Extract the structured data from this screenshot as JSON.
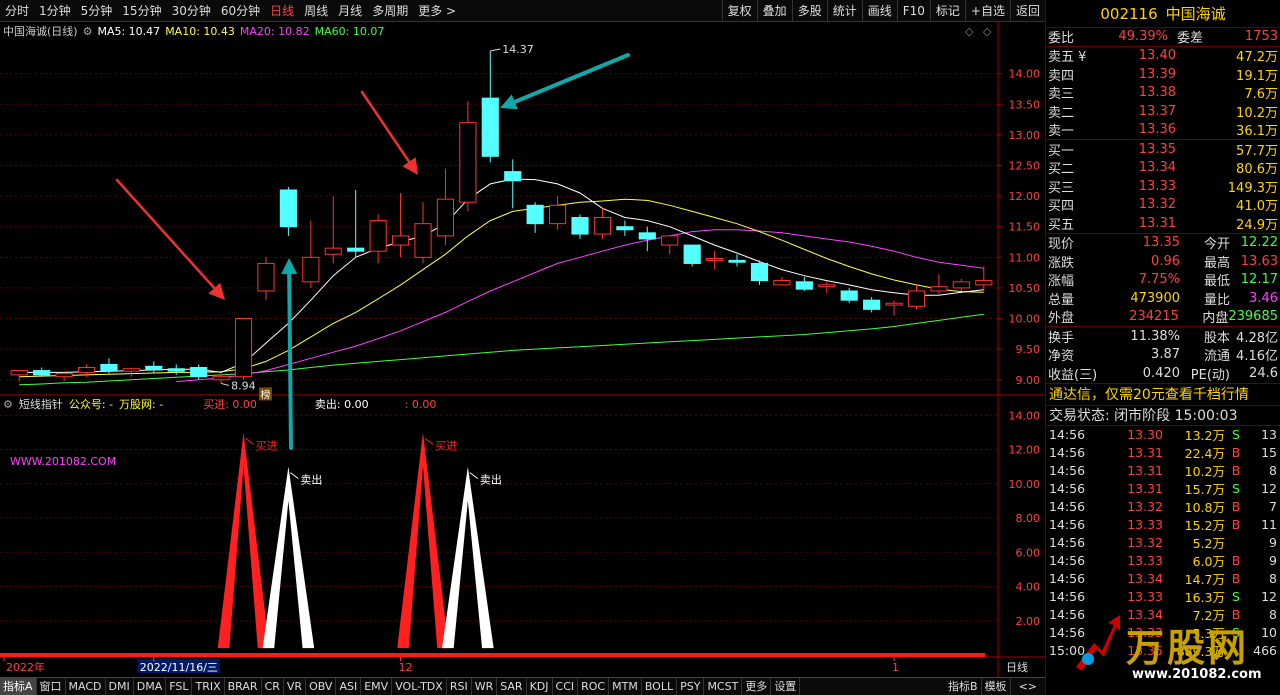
{
  "toolbar": {
    "periods": [
      "分时",
      "1分钟",
      "5分钟",
      "15分钟",
      "30分钟",
      "60分钟",
      "日线",
      "周线",
      "月线",
      "多周期",
      "更多"
    ],
    "active_period": "日线",
    "more_arrow": ">",
    "right_buttons": [
      "复权",
      "叠加",
      "多股",
      "统计",
      "画线",
      "F10",
      "标记",
      "+自选",
      "返回"
    ]
  },
  "main_legend": {
    "title": "中国海诚(日线)",
    "ma5": "MA5: 10.47",
    "ma10": "MA10: 10.43",
    "ma20": "MA20: 10.82",
    "ma60": "MA60: 10.07",
    "ma5_color": "#ffffff",
    "ma10_color": "#ffff40",
    "ma20_color": "#ff40ff",
    "ma60_color": "#40ff40"
  },
  "indicator_legend": {
    "name": "短线指针",
    "gzh": "公众号: -",
    "site": "万股网: -",
    "buy": "买进: 0.00",
    "sell": "卖出: 0.00",
    "extra": ": 0.00"
  },
  "chart_data": {
    "type": "candlestick",
    "y_ticks": [
      "14.00",
      "13.50",
      "13.00",
      "12.50",
      "12.00",
      "11.50",
      "11.00",
      "10.50",
      "10.00",
      "9.50",
      "9.00"
    ],
    "ylim": [
      8.8,
      14.55
    ],
    "high_label": "14.37",
    "low_label": "8.94",
    "badge": "榜",
    "candles": [
      {
        "o": 9.08,
        "h": 9.15,
        "l": 8.97,
        "c": 9.15
      },
      {
        "o": 9.15,
        "h": 9.2,
        "l": 9.05,
        "c": 9.08
      },
      {
        "o": 9.05,
        "h": 9.12,
        "l": 8.98,
        "c": 9.1
      },
      {
        "o": 9.12,
        "h": 9.25,
        "l": 9.05,
        "c": 9.2
      },
      {
        "o": 9.25,
        "h": 9.35,
        "l": 9.1,
        "c": 9.15
      },
      {
        "o": 9.14,
        "h": 9.2,
        "l": 9.05,
        "c": 9.18
      },
      {
        "o": 9.22,
        "h": 9.3,
        "l": 9.12,
        "c": 9.16
      },
      {
        "o": 9.18,
        "h": 9.25,
        "l": 9.08,
        "c": 9.14
      },
      {
        "o": 9.2,
        "h": 9.25,
        "l": 9.0,
        "c": 9.05
      },
      {
        "o": 9.0,
        "h": 9.1,
        "l": 8.94,
        "c": 9.05
      },
      {
        "o": 9.05,
        "h": 10.0,
        "l": 9.0,
        "c": 10.0
      },
      {
        "o": 10.45,
        "h": 11.0,
        "l": 10.3,
        "c": 10.9
      },
      {
        "o": 12.1,
        "h": 12.15,
        "l": 11.35,
        "c": 11.5
      },
      {
        "o": 10.6,
        "h": 11.6,
        "l": 10.5,
        "c": 11.0
      },
      {
        "o": 11.05,
        "h": 12.0,
        "l": 10.9,
        "c": 11.15
      },
      {
        "o": 11.15,
        "h": 12.1,
        "l": 11.0,
        "c": 11.1
      },
      {
        "o": 11.1,
        "h": 11.7,
        "l": 10.9,
        "c": 11.6
      },
      {
        "o": 11.2,
        "h": 12.05,
        "l": 11.0,
        "c": 11.35
      },
      {
        "o": 11.0,
        "h": 11.9,
        "l": 10.9,
        "c": 11.55
      },
      {
        "o": 11.35,
        "h": 12.45,
        "l": 11.2,
        "c": 11.95
      },
      {
        "o": 11.9,
        "h": 13.55,
        "l": 11.75,
        "c": 13.2
      },
      {
        "o": 13.6,
        "h": 14.37,
        "l": 12.55,
        "c": 12.65
      },
      {
        "o": 12.4,
        "h": 12.6,
        "l": 11.8,
        "c": 12.25
      },
      {
        "o": 11.85,
        "h": 11.9,
        "l": 11.4,
        "c": 11.55
      },
      {
        "o": 11.55,
        "h": 12.0,
        "l": 11.45,
        "c": 11.85
      },
      {
        "o": 11.65,
        "h": 11.7,
        "l": 11.3,
        "c": 11.38
      },
      {
        "o": 11.38,
        "h": 11.8,
        "l": 11.3,
        "c": 11.65
      },
      {
        "o": 11.5,
        "h": 11.6,
        "l": 11.35,
        "c": 11.45
      },
      {
        "o": 11.4,
        "h": 11.5,
        "l": 11.1,
        "c": 11.3
      },
      {
        "o": 11.2,
        "h": 11.35,
        "l": 11.05,
        "c": 11.35
      },
      {
        "o": 11.2,
        "h": 11.2,
        "l": 10.85,
        "c": 10.9
      },
      {
        "o": 10.95,
        "h": 11.1,
        "l": 10.8,
        "c": 10.98
      },
      {
        "o": 10.95,
        "h": 11.05,
        "l": 10.85,
        "c": 10.92
      },
      {
        "o": 10.9,
        "h": 10.95,
        "l": 10.55,
        "c": 10.62
      },
      {
        "o": 10.55,
        "h": 10.68,
        "l": 10.55,
        "c": 10.62
      },
      {
        "o": 10.6,
        "h": 10.68,
        "l": 10.45,
        "c": 10.48
      },
      {
        "o": 10.52,
        "h": 10.6,
        "l": 10.42,
        "c": 10.55
      },
      {
        "o": 10.45,
        "h": 10.5,
        "l": 10.25,
        "c": 10.3
      },
      {
        "o": 10.3,
        "h": 10.35,
        "l": 10.1,
        "c": 10.15
      },
      {
        "o": 10.22,
        "h": 10.3,
        "l": 10.05,
        "c": 10.25
      },
      {
        "o": 10.2,
        "h": 10.55,
        "l": 10.15,
        "c": 10.45
      },
      {
        "o": 10.45,
        "h": 10.72,
        "l": 10.4,
        "c": 10.52
      },
      {
        "o": 10.5,
        "h": 10.65,
        "l": 10.45,
        "c": 10.6
      },
      {
        "o": 10.55,
        "h": 10.85,
        "l": 10.45,
        "c": 10.62
      }
    ],
    "ma5": [
      9.12,
      9.12,
      9.12,
      9.13,
      9.14,
      9.15,
      9.16,
      9.17,
      9.17,
      9.12,
      9.27,
      9.6,
      9.92,
      10.3,
      10.7,
      11.0,
      11.15,
      11.25,
      11.35,
      11.55,
      11.95,
      12.2,
      12.28,
      12.27,
      12.2,
      12.05,
      11.8,
      11.65,
      11.6,
      11.5,
      11.35,
      11.2,
      11.07,
      10.93,
      10.8,
      10.7,
      10.62,
      10.55,
      10.47,
      10.42,
      10.38,
      10.38,
      10.43,
      10.47
    ],
    "ma10": [
      9.05,
      9.06,
      9.07,
      9.08,
      9.09,
      9.1,
      9.11,
      9.12,
      9.12,
      9.13,
      9.18,
      9.3,
      9.48,
      9.7,
      9.92,
      10.1,
      10.32,
      10.55,
      10.8,
      11.05,
      11.35,
      11.6,
      11.75,
      11.8,
      11.85,
      11.9,
      11.92,
      11.95,
      11.93,
      11.85,
      11.75,
      11.65,
      11.55,
      11.42,
      11.28,
      11.13,
      10.98,
      10.85,
      10.73,
      10.63,
      10.55,
      10.48,
      10.44,
      10.43
    ],
    "ma20": [
      null,
      null,
      null,
      null,
      null,
      null,
      null,
      8.97,
      9.0,
      9.03,
      9.08,
      9.15,
      9.25,
      9.35,
      9.45,
      9.55,
      9.67,
      9.8,
      9.95,
      10.1,
      10.28,
      10.45,
      10.6,
      10.75,
      10.9,
      11.0,
      11.1,
      11.2,
      11.28,
      11.35,
      11.42,
      11.45,
      11.45,
      11.43,
      11.4,
      11.35,
      11.3,
      11.25,
      11.18,
      11.1,
      11.0,
      10.92,
      10.87,
      10.82
    ],
    "ma60": [
      8.92,
      8.93,
      8.95,
      8.96,
      8.98,
      9.0,
      9.02,
      9.04,
      9.06,
      9.08,
      9.1,
      9.13,
      9.16,
      9.2,
      9.24,
      9.27,
      9.3,
      9.33,
      9.36,
      9.39,
      9.42,
      9.45,
      9.48,
      9.5,
      9.52,
      9.54,
      9.56,
      9.58,
      9.6,
      9.62,
      9.64,
      9.66,
      9.68,
      9.7,
      9.72,
      9.74,
      9.77,
      9.8,
      9.83,
      9.87,
      9.92,
      9.97,
      10.02,
      10.07
    ],
    "ind_ticks": [
      "14.00",
      "12.00",
      "10.00",
      "8.00",
      "6.00",
      "4.00",
      "2.00"
    ],
    "ind_ylim": [
      0,
      14.6
    ],
    "ind_items": [
      {
        "name": "buy",
        "label": "买进",
        "idx": 10,
        "value": 13.0
      },
      {
        "name": "sell",
        "label": "卖出",
        "idx": 12,
        "value": 11.0
      },
      {
        "name": "buy",
        "label": "买进",
        "idx": 18,
        "value": 13.0
      },
      {
        "name": "sell",
        "label": "卖出",
        "idx": 20,
        "value": 11.0
      }
    ],
    "ind_watermark": "WWW.201082.COM",
    "date_labels": [
      {
        "text": "2022年",
        "idx": 0
      },
      {
        "text": "2022/11/16/三",
        "idx": 6,
        "highlight": true
      },
      {
        "text": "12",
        "idx": 17
      },
      {
        "text": "1",
        "idx": 39
      }
    ],
    "period_label": "日线"
  },
  "bottom_tabs": [
    "指标A",
    "窗口",
    "MACD",
    "DMI",
    "DMA",
    "FSL",
    "TRIX",
    "BRAR",
    "CR",
    "VR",
    "OBV",
    "ASI",
    "EMV",
    "VOL-TDX",
    "RSI",
    "WR",
    "SAR",
    "KDJ",
    "CCI",
    "ROC",
    "MTM",
    "BOLL",
    "PSY",
    "MCST",
    "更多",
    "设置"
  ],
  "bottom_right": [
    "指标B",
    "模板"
  ],
  "bottom_arrows": "<>",
  "right_panel": {
    "code": "002116",
    "name": "中国海诚",
    "weibi_label": "委比",
    "weibi": "49.39%",
    "weicha_label": "委差",
    "weicha": "1753",
    "sell": [
      {
        "label": "卖五",
        "mark": "¥",
        "price": "13.40",
        "vol": "47.2万"
      },
      {
        "label": "卖四",
        "mark": "",
        "price": "13.39",
        "vol": "19.1万"
      },
      {
        "label": "卖三",
        "mark": "",
        "price": "13.38",
        "vol": "7.6万"
      },
      {
        "label": "卖二",
        "mark": "",
        "price": "13.37",
        "vol": "10.2万"
      },
      {
        "label": "卖一",
        "mark": "",
        "price": "13.36",
        "vol": "36.1万"
      }
    ],
    "buy": [
      {
        "label": "买一",
        "price": "13.35",
        "vol": "57.7万"
      },
      {
        "label": "买二",
        "price": "13.34",
        "vol": "80.6万"
      },
      {
        "label": "买三",
        "price": "13.33",
        "vol": "149.3万"
      },
      {
        "label": "买四",
        "price": "13.32",
        "vol": "41.0万"
      },
      {
        "label": "买五",
        "price": "13.31",
        "vol": "24.9万"
      }
    ],
    "quote": [
      [
        {
          "t": "现价",
          "c": "#ddd"
        },
        {
          "t": "13.35",
          "c": "#ff4040"
        },
        {
          "t": "今开",
          "c": "#ddd"
        },
        {
          "t": "12.22",
          "c": "#40ff40"
        }
      ],
      [
        {
          "t": "涨跌",
          "c": "#ddd"
        },
        {
          "t": "0.96",
          "c": "#ff4040"
        },
        {
          "t": "最高",
          "c": "#ddd"
        },
        {
          "t": "13.63",
          "c": "#ff4040"
        }
      ],
      [
        {
          "t": "涨幅",
          "c": "#ddd"
        },
        {
          "t": "7.75%",
          "c": "#ff4040"
        },
        {
          "t": "最低",
          "c": "#ddd"
        },
        {
          "t": "12.17",
          "c": "#40ff40"
        }
      ],
      [
        {
          "t": "总量",
          "c": "#ddd"
        },
        {
          "t": "473900",
          "c": "#ffd400"
        },
        {
          "t": "量比",
          "c": "#ddd"
        },
        {
          "t": "3.46",
          "c": "#ff40ff"
        }
      ],
      [
        {
          "t": "外盘",
          "c": "#ddd"
        },
        {
          "t": "234215",
          "c": "#ff4040"
        },
        {
          "t": "内盘",
          "c": "#ddd"
        },
        {
          "t": "239685",
          "c": "#40ff40"
        }
      ]
    ],
    "quote2": [
      [
        {
          "t": "换手",
          "c": "#ddd"
        },
        {
          "t": "11.38%",
          "c": "#ddd"
        },
        {
          "t": "股本",
          "c": "#ddd"
        },
        {
          "t": "4.28亿",
          "c": "#ddd"
        }
      ],
      [
        {
          "t": "净资",
          "c": "#ddd"
        },
        {
          "t": "3.87",
          "c": "#ddd"
        },
        {
          "t": "流通",
          "c": "#ddd"
        },
        {
          "t": "4.16亿",
          "c": "#ddd"
        }
      ],
      [
        {
          "t": "收益(三)",
          "c": "#ddd"
        },
        {
          "t": "0.420",
          "c": "#ddd"
        },
        {
          "t": "PE(动)",
          "c": "#ddd"
        },
        {
          "t": "24.6",
          "c": "#ddd"
        }
      ]
    ],
    "notice": "通达信，仅需20元查看千档行情",
    "status": "交易状态: 闭市阶段 15:00:03",
    "ticks": [
      {
        "t": "14:56",
        "p": "13.30",
        "v": "13.2万",
        "s": "S",
        "n": "13"
      },
      {
        "t": "14:56",
        "p": "13.31",
        "v": "22.4万",
        "s": "B",
        "n": "15"
      },
      {
        "t": "14:56",
        "p": "13.31",
        "v": "10.2万",
        "s": "B",
        "n": "8"
      },
      {
        "t": "14:56",
        "p": "13.31",
        "v": "15.7万",
        "s": "S",
        "n": "12"
      },
      {
        "t": "14:56",
        "p": "13.32",
        "v": "10.8万",
        "s": "B",
        "n": "7"
      },
      {
        "t": "14:56",
        "p": "13.33",
        "v": "15.2万",
        "s": "B",
        "n": "11"
      },
      {
        "t": "14:56",
        "p": "13.32",
        "v": "5.2万",
        "s": "",
        "n": "9"
      },
      {
        "t": "14:56",
        "p": "13.33",
        "v": "6.0万",
        "s": "B",
        "n": "9"
      },
      {
        "t": "14:56",
        "p": "13.34",
        "v": "14.7万",
        "s": "B",
        "n": "8"
      },
      {
        "t": "14:56",
        "p": "13.33",
        "v": "16.3万",
        "s": "S",
        "n": "12"
      },
      {
        "t": "14:56",
        "p": "13.34",
        "v": "7.2万",
        "s": "B",
        "n": "8"
      },
      {
        "t": "14:56",
        "p": "13.33",
        "v": "5.3万",
        "s": "S",
        "n": "10"
      },
      {
        "t": "15:00",
        "p": "13.35",
        "v": "889.3万",
        "s": "",
        "n": "466"
      }
    ],
    "watermark_big": "万股网",
    "watermark_url": "www.201082.com"
  }
}
